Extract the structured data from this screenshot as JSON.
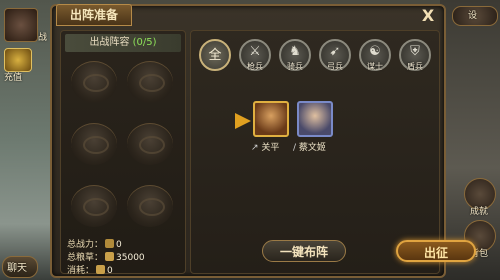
{
  "window": {
    "title": "出阵准备",
    "close_glyph": "X"
  },
  "sidebar_left": {
    "portrait_label": "战",
    "recharge_label": "充值",
    "chat_label": "聊天"
  },
  "sidebar_right": {
    "top_button_label": "设",
    "item1_label": "成就",
    "item2_label": "背包"
  },
  "lineup": {
    "header_label": "出战阵容",
    "count": "(0/5)",
    "slots": [
      {},
      {},
      {},
      {},
      {},
      {}
    ]
  },
  "stats": {
    "power_label": "总战力：",
    "power_value": "0",
    "food_label": "总粮草：",
    "food_value": "35000",
    "cost_label": "消耗：",
    "cost_value": "0"
  },
  "filters": [
    {
      "label": "",
      "glyph": "全",
      "active": true
    },
    {
      "label": "枪兵",
      "glyph": "⚔"
    },
    {
      "label": "骑兵",
      "glyph": "♞"
    },
    {
      "label": "弓兵",
      "glyph": "➹"
    },
    {
      "label": "谋士",
      "glyph": "☯"
    },
    {
      "label": "盾兵",
      "glyph": "⛨"
    }
  ],
  "heroes": [
    {
      "name": "关平",
      "color": "#c8a050",
      "type_icon": "spear"
    },
    {
      "name": "蔡文姬",
      "color": "#6a7aa8",
      "type_icon": "staff"
    }
  ],
  "buttons": {
    "auto_deploy": "一键布阵",
    "deploy": "出征"
  }
}
